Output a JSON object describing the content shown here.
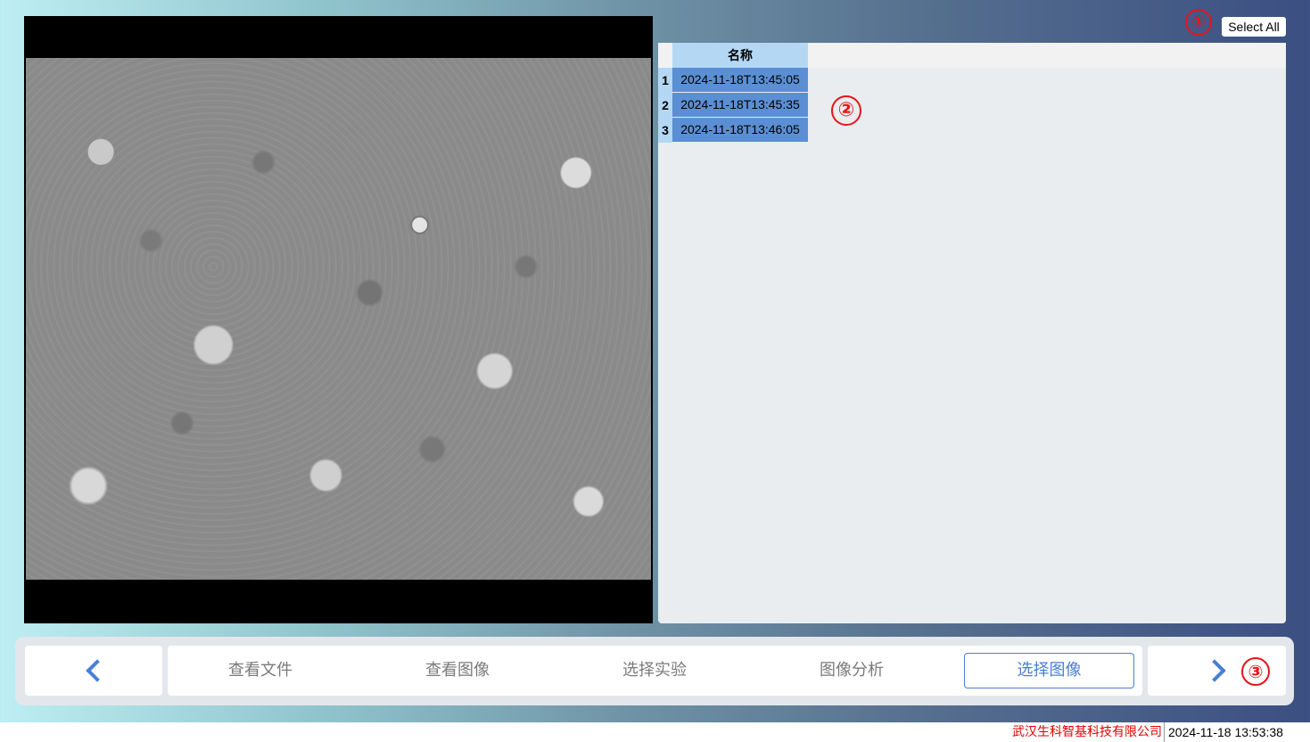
{
  "toolbar": {
    "select_all_label": "Select All"
  },
  "markers": {
    "m1": "①",
    "m2": "②",
    "m3": "③"
  },
  "table": {
    "column_header": "名称",
    "rows": [
      {
        "num": "1",
        "name": "2024-11-18T13:45:05"
      },
      {
        "num": "2",
        "name": "2024-11-18T13:45:35"
      },
      {
        "num": "3",
        "name": "2024-11-18T13:46:05"
      }
    ]
  },
  "nav": {
    "prev_icon": "chevron-left-icon",
    "next_icon": "chevron-right-icon",
    "tabs": [
      "查看文件",
      "查看图像",
      "选择实验",
      "图像分析"
    ],
    "active_tab": "选择图像"
  },
  "footer": {
    "company": "武汉生科智基科技有限公司",
    "datetime": "2024-11-18 13:53:38"
  },
  "colors": {
    "accent": "#4a7fd4",
    "selected_row": "#5b8fd3",
    "header_cell": "#b4d8f4",
    "marker": "#e8141a"
  }
}
